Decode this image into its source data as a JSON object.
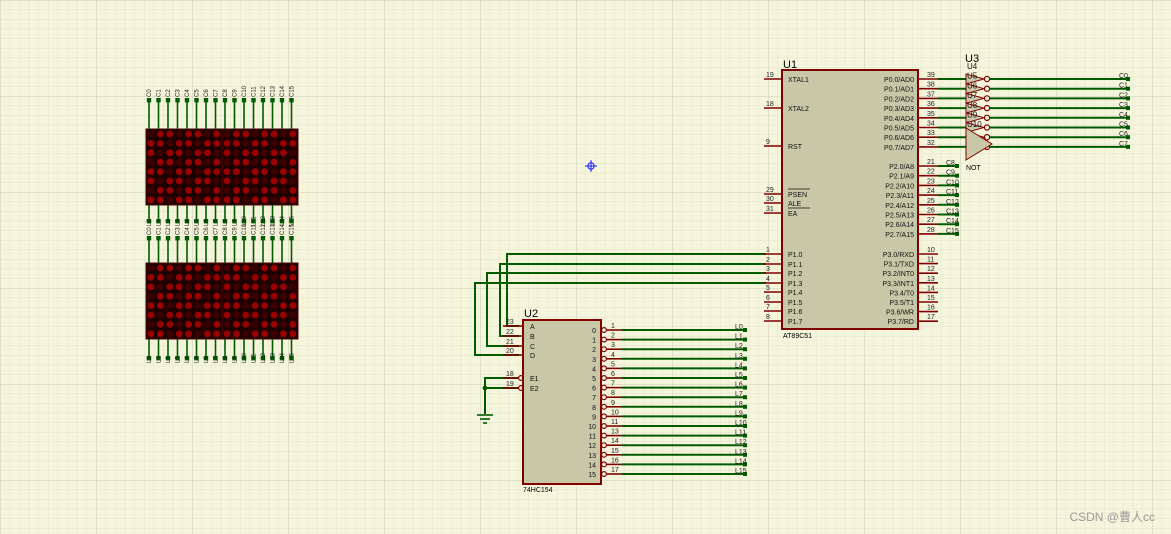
{
  "u1": {
    "ref": "U1",
    "part": "AT89C51",
    "left_pins": [
      {
        "num": "19",
        "name": "XTAL1",
        "clock": true
      },
      {
        "num": "18",
        "name": "XTAL2"
      },
      {
        "num": "9",
        "name": "RST"
      },
      {
        "num": "29",
        "name": "PSEN",
        "over": true
      },
      {
        "num": "30",
        "name": "ALE"
      },
      {
        "num": "31",
        "name": "EA",
        "over": true
      },
      {
        "num": "1",
        "name": "P1.0"
      },
      {
        "num": "2",
        "name": "P1.1"
      },
      {
        "num": "3",
        "name": "P1.2"
      },
      {
        "num": "4",
        "name": "P1.3"
      },
      {
        "num": "5",
        "name": "P1.4"
      },
      {
        "num": "6",
        "name": "P1.5"
      },
      {
        "num": "7",
        "name": "P1.6"
      },
      {
        "num": "8",
        "name": "P1.7"
      }
    ],
    "right_pins": [
      {
        "num": "39",
        "name": "P0.0/AD0"
      },
      {
        "num": "38",
        "name": "P0.1/AD1"
      },
      {
        "num": "37",
        "name": "P0.2/AD2"
      },
      {
        "num": "36",
        "name": "P0.3/AD3"
      },
      {
        "num": "35",
        "name": "P0.4/AD4"
      },
      {
        "num": "34",
        "name": "P0.5/AD5"
      },
      {
        "num": "33",
        "name": "P0.6/AD6"
      },
      {
        "num": "32",
        "name": "P0.7/AD7"
      },
      {
        "num": "21",
        "name": "P2.0/A8"
      },
      {
        "num": "22",
        "name": "P2.1/A9"
      },
      {
        "num": "23",
        "name": "P2.2/A10"
      },
      {
        "num": "24",
        "name": "P2.3/A11"
      },
      {
        "num": "25",
        "name": "P2.4/A12"
      },
      {
        "num": "26",
        "name": "P2.5/A13"
      },
      {
        "num": "27",
        "name": "P2.6/A14"
      },
      {
        "num": "28",
        "name": "P2.7/A15"
      },
      {
        "num": "10",
        "name": "P3.0/RXD"
      },
      {
        "num": "11",
        "name": "P3.1/TXD"
      },
      {
        "num": "12",
        "name": "P3.2/INT0"
      },
      {
        "num": "13",
        "name": "P3.3/INT1"
      },
      {
        "num": "14",
        "name": "P3.4/T0"
      },
      {
        "num": "15",
        "name": "P3.5/T1"
      },
      {
        "num": "16",
        "name": "P3.6/WR"
      },
      {
        "num": "17",
        "name": "P3.7/RD"
      }
    ],
    "p2_nets": [
      "C8",
      "C9",
      "C10",
      "C11",
      "C12",
      "C13",
      "C14",
      "C15"
    ]
  },
  "u2": {
    "ref": "U2",
    "part": "74HC154",
    "left_pins": [
      {
        "num": "23",
        "name": "A"
      },
      {
        "num": "22",
        "name": "B"
      },
      {
        "num": "21",
        "name": "C"
      },
      {
        "num": "20",
        "name": "D"
      },
      {
        "num": "18",
        "name": "E1"
      },
      {
        "num": "19",
        "name": "E2"
      }
    ],
    "outputs": [
      {
        "name": "0",
        "num": "1",
        "net": "L0"
      },
      {
        "name": "1",
        "num": "2",
        "net": "L1"
      },
      {
        "name": "2",
        "num": "3",
        "net": "L2"
      },
      {
        "name": "3",
        "num": "4",
        "net": "L3"
      },
      {
        "name": "4",
        "num": "5",
        "net": "L4"
      },
      {
        "name": "5",
        "num": "6",
        "net": "L5"
      },
      {
        "name": "6",
        "num": "7",
        "net": "L6"
      },
      {
        "name": "7",
        "num": "8",
        "net": "L7"
      },
      {
        "name": "8",
        "num": "9",
        "net": "L8"
      },
      {
        "name": "9",
        "num": "10",
        "net": "L9"
      },
      {
        "name": "10",
        "num": "11",
        "net": "L10"
      },
      {
        "name": "11",
        "num": "13",
        "net": "L11"
      },
      {
        "name": "12",
        "num": "14",
        "net": "L12"
      },
      {
        "name": "13",
        "num": "15",
        "net": "L13"
      },
      {
        "name": "14",
        "num": "16",
        "net": "L14"
      },
      {
        "name": "15",
        "num": "17",
        "net": "L15"
      }
    ]
  },
  "u3": {
    "ref": "U3",
    "gate_labels": [
      "U4",
      "U5",
      "U6",
      "U7",
      "U8",
      "U9",
      "U10"
    ],
    "part": "NOT",
    "out_nets": [
      "C0",
      "C1",
      "C2",
      "C3",
      "C4",
      "C5",
      "C6",
      "C7"
    ]
  },
  "matrix_top_labels": [
    "C0",
    "C1",
    "C2",
    "C3",
    "C4",
    "C5",
    "C6",
    "C7",
    "C8",
    "C9",
    "C10",
    "C11",
    "C12",
    "C13",
    "C14",
    "C15"
  ],
  "matrix_bottom_labels": [
    "L0",
    "L1",
    "L2",
    "L3",
    "L4",
    "L5",
    "L6",
    "L7",
    "L8",
    "L9",
    "L10",
    "L11",
    "L12",
    "L13",
    "L14",
    "L15"
  ],
  "watermark": "CSDN @曹人cc",
  "colors": {
    "background": "#f5f5dc",
    "grid": "#d6d6c2",
    "wire": "#005a00",
    "pin": "#800000",
    "chip_fill": "#c8c8a8",
    "led_off": "#3d0000",
    "led_on": "#9a0000"
  }
}
